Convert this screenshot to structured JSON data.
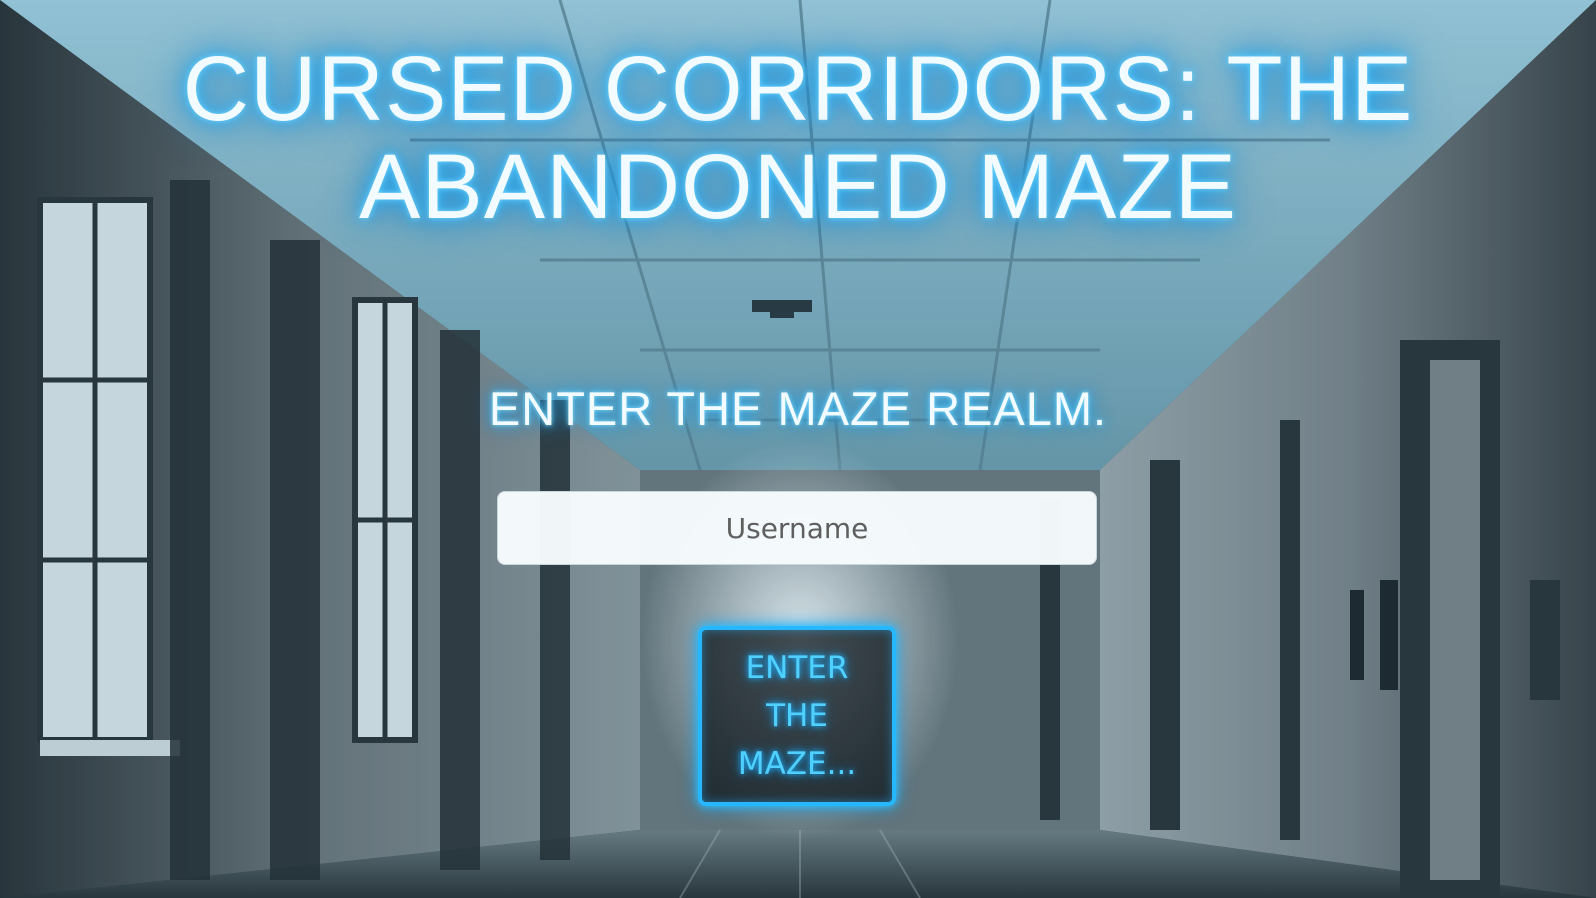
{
  "title": "CURSED CORRIDORS: THE ABANDONED MAZE",
  "prompt": "ENTER THE MAZE REALM.",
  "username_input": {
    "placeholder": "Username",
    "value": ""
  },
  "enter_button": {
    "label": "ENTER THE MAZE..."
  },
  "colors": {
    "glow_accent": "#26b8ff",
    "title_text": "#f2fbff",
    "button_text": "#4fd0ff"
  }
}
